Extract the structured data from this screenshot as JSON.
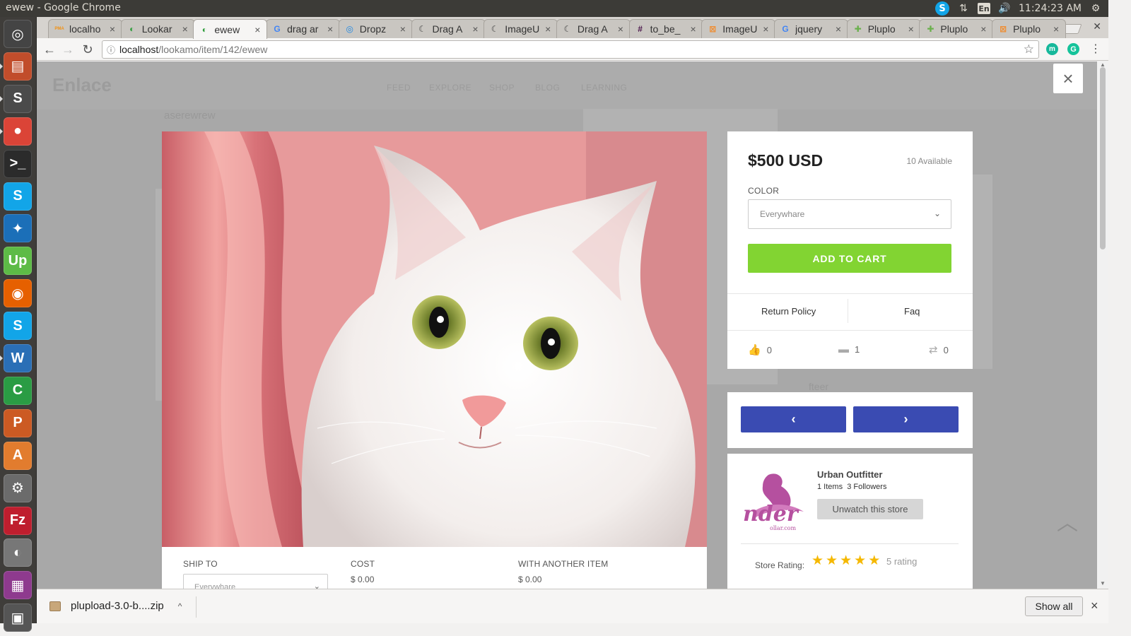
{
  "os": {
    "window_title": "ewew - Google Chrome",
    "clock": "11:24:23 AM",
    "lang": "En",
    "skype_icon": "S",
    "network_icon": "⇅",
    "volume_icon": "🔊",
    "settings_icon": "⚙"
  },
  "launcher": [
    {
      "name": "dash",
      "glyph": "◎",
      "color": "#444"
    },
    {
      "name": "files",
      "glyph": "▤",
      "color": "#c14d2b"
    },
    {
      "name": "sublime-text",
      "glyph": "S",
      "color": "#4b4b4b"
    },
    {
      "name": "chrome",
      "glyph": "●",
      "color": "#db4437"
    },
    {
      "name": "terminal",
      "glyph": ">_",
      "color": "#2b2b2b"
    },
    {
      "name": "skype",
      "glyph": "S",
      "color": "#12a5e8"
    },
    {
      "name": "app-blue",
      "glyph": "✦",
      "color": "#1b6fb8"
    },
    {
      "name": "upwork",
      "glyph": "Up",
      "color": "#5dbb46"
    },
    {
      "name": "firefox",
      "glyph": "◉",
      "color": "#e66000"
    },
    {
      "name": "skype-2",
      "glyph": "S",
      "color": "#12a5e8"
    },
    {
      "name": "writer",
      "glyph": "W",
      "color": "#2a6fb6"
    },
    {
      "name": "calc",
      "glyph": "C",
      "color": "#2a9c44"
    },
    {
      "name": "impress",
      "glyph": "P",
      "color": "#cc5a23"
    },
    {
      "name": "software-center",
      "glyph": "A",
      "color": "#e27c2e"
    },
    {
      "name": "settings",
      "glyph": "⚙",
      "color": "#6b6b6b"
    },
    {
      "name": "filezilla",
      "glyph": "Fz",
      "color": "#bf1e2e"
    },
    {
      "name": "screenshot",
      "glyph": "◐",
      "color": "#777"
    },
    {
      "name": "workspace",
      "glyph": "▦",
      "color": "#8e3a8e"
    },
    {
      "name": "trash",
      "glyph": "▣",
      "color": "#555"
    }
  ],
  "tabs": [
    {
      "title": "localho",
      "icon": "PMA",
      "icon_color": "#f29111"
    },
    {
      "title": "Lookar",
      "icon": "◐",
      "icon_color": "#2e9d3b"
    },
    {
      "title": "ewew",
      "icon": "◐",
      "icon_color": "#2e9d3b",
      "active": true
    },
    {
      "title": "drag ar",
      "icon": "G",
      "icon_color": "#4285f4"
    },
    {
      "title": "Dropz",
      "icon": "◎",
      "icon_color": "#1e88e5"
    },
    {
      "title": "Drag A",
      "icon": "☾",
      "icon_color": "#444"
    },
    {
      "title": "ImageU",
      "icon": "☾",
      "icon_color": "#444"
    },
    {
      "title": "Drag A",
      "icon": "☾",
      "icon_color": "#444"
    },
    {
      "title": "to_be_",
      "icon": "#",
      "icon_color": "#4a154b"
    },
    {
      "title": "ImageU",
      "icon": "⊠",
      "icon_color": "#f08c2e"
    },
    {
      "title": "jquery",
      "icon": "G",
      "icon_color": "#4285f4"
    },
    {
      "title": "Pluplo",
      "icon": "✚",
      "icon_color": "#6ab04c"
    },
    {
      "title": "Pluplo",
      "icon": "✚",
      "icon_color": "#6ab04c"
    },
    {
      "title": "Pluplo",
      "icon": "⊠",
      "icon_color": "#f08c2e"
    }
  ],
  "toolbar": {
    "back": "←",
    "forward": "→",
    "reload": "↻",
    "info_icon": "ⓘ",
    "url_host": "localhost",
    "url_path": "/lookamo/item/142/ewew",
    "star": "☆",
    "ext_m": "m",
    "ext_g": "G",
    "menu": "⋮"
  },
  "background_page": {
    "logo": "Enlace",
    "nav": [
      "FEED",
      "EXPLORE",
      "SHOP",
      "BLOG",
      "LEARNING"
    ],
    "item_title": "aserewrew",
    "item_title_2": "fteer"
  },
  "modal": {
    "close": "×",
    "price": "$500 USD",
    "available": "10 Available",
    "color_label": "COLOR",
    "color_value": "Everywhare",
    "add_to_cart": "ADD TO CART",
    "return_policy": "Return Policy",
    "faq": "Faq",
    "likes": "0",
    "comments": "1",
    "reposts": "0",
    "prev": "‹",
    "next": "›",
    "ship_to_label": "SHIP TO",
    "ship_to_value": "Everywhare",
    "cost_label": "COST",
    "cost_value": "$ 0.00",
    "another_label": "WITH ANOTHER ITEM",
    "another_value": "$ 0.00",
    "store": {
      "name": "Urban Outfitter",
      "items": "1 Items",
      "followers": "3 Followers",
      "unwatch": "Unwatch this store",
      "rating_label": "Store Rating:",
      "rating_value": 5,
      "rating_text": "5 rating",
      "star": "★"
    }
  },
  "downloads": {
    "file": "plupload-3.0-b....zip",
    "chevron": "^",
    "show_all": "Show all",
    "close": "×"
  },
  "colors": {
    "cart_green": "#82d432",
    "nav_blue": "#3a4bb2",
    "star_gold": "#f5b800"
  }
}
